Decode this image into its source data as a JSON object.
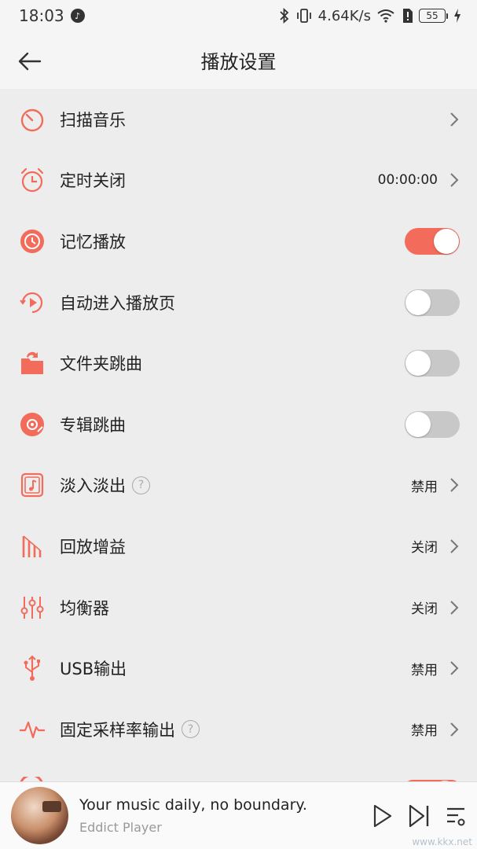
{
  "status": {
    "time": "18:03",
    "net_speed": "4.64K/s",
    "battery": "55"
  },
  "header": {
    "title": "播放设置"
  },
  "settings": [
    {
      "label": "扫描音乐",
      "value": "",
      "type": "link"
    },
    {
      "label": "定时关闭",
      "value": "00:00:00",
      "type": "link"
    },
    {
      "label": "记忆播放",
      "value": "",
      "type": "toggle",
      "on": true
    },
    {
      "label": "自动进入播放页",
      "value": "",
      "type": "toggle",
      "on": false
    },
    {
      "label": "文件夹跳曲",
      "value": "",
      "type": "toggle",
      "on": false
    },
    {
      "label": "专辑跳曲",
      "value": "",
      "type": "toggle",
      "on": false
    },
    {
      "label": "淡入淡出",
      "value": "禁用",
      "type": "link",
      "help": true
    },
    {
      "label": "回放增益",
      "value": "关闭",
      "type": "link"
    },
    {
      "label": "均衡器",
      "value": "关闭",
      "type": "link"
    },
    {
      "label": "USB输出",
      "value": "禁用",
      "type": "link"
    },
    {
      "label": "固定采样率输出",
      "value": "禁用",
      "type": "link",
      "help": true
    }
  ],
  "icons": [
    "timer-icon",
    "alarm-clock-icon",
    "memory-play-icon",
    "auto-play-icon",
    "folder-skip-icon",
    "album-disc-icon",
    "fade-icon",
    "replay-gain-icon",
    "equalizer-icon",
    "usb-icon",
    "sample-rate-icon"
  ],
  "player": {
    "song": "Your music daily, no boundary.",
    "artist": "Eddict Player"
  },
  "watermark": "www.kkx.net",
  "colors": {
    "accent": "#f26b5b",
    "toggle_off": "#c8c8c8",
    "background": "#ededed"
  }
}
